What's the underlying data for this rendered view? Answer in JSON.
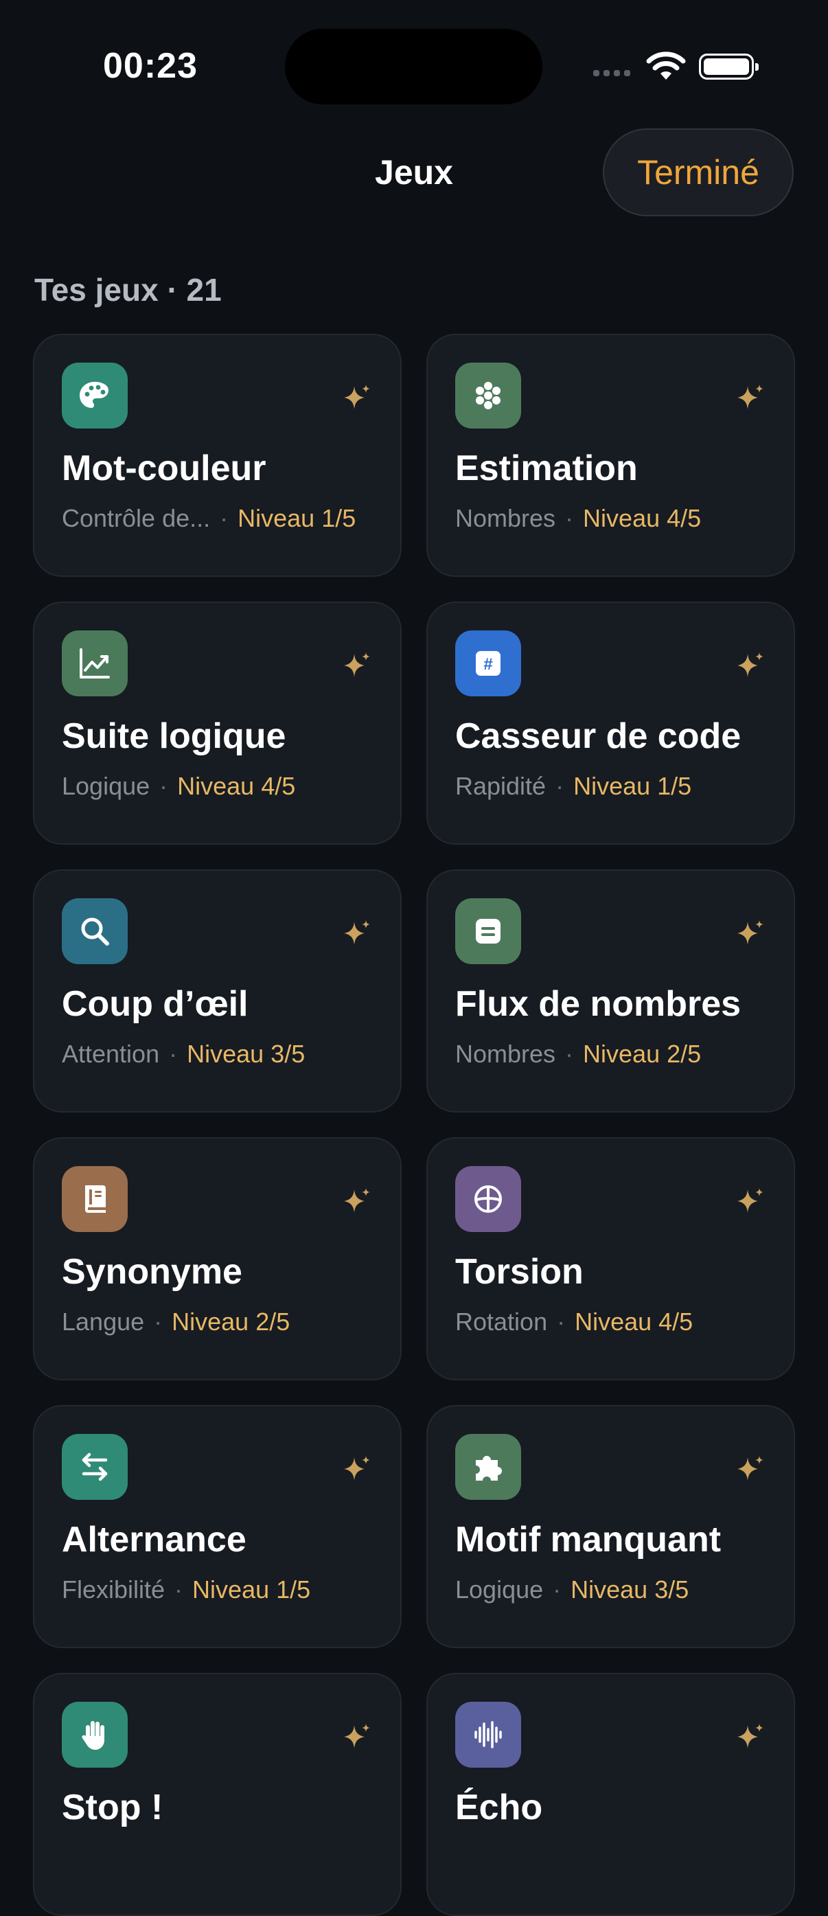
{
  "status_bar": {
    "time": "00:23"
  },
  "nav": {
    "title": "Jeux",
    "done_label": "Terminé"
  },
  "section": {
    "title": "Tes jeux · 21"
  },
  "colors": {
    "accent": "#f0a73a",
    "level": "#e7b865"
  },
  "games": [
    {
      "title": "Mot-couleur",
      "category": "Contrôle de...",
      "level": "Niveau 1/5",
      "icon": "palette-icon",
      "color": "#2f8a76"
    },
    {
      "title": "Estimation",
      "category": "Nombres",
      "level": "Niveau 4/5",
      "icon": "dots-cluster-icon",
      "color": "#4e7a5c"
    },
    {
      "title": "Suite logique",
      "category": "Logique",
      "level": "Niveau 4/5",
      "icon": "chart-trend-icon",
      "color": "#4a7a5a"
    },
    {
      "title": "Casseur de code",
      "category": "Rapidité",
      "level": "Niveau 1/5",
      "icon": "hashtag-icon",
      "color": "#2f6fcf"
    },
    {
      "title": "Coup d’œil",
      "category": "Attention",
      "level": "Niveau 3/5",
      "icon": "magnifier-icon",
      "color": "#2b6f86"
    },
    {
      "title": "Flux de nombres",
      "category": "Nombres",
      "level": "Niveau 2/5",
      "icon": "stream-card-icon",
      "color": "#4e7a5c"
    },
    {
      "title": "Synonyme",
      "category": "Langue",
      "level": "Niveau 2/5",
      "icon": "book-icon",
      "color": "#9a6e4c"
    },
    {
      "title": "Torsion",
      "category": "Rotation",
      "level": "Niveau 4/5",
      "icon": "globe-icon",
      "color": "#6f5a8e"
    },
    {
      "title": "Alternance",
      "category": "Flexibilité",
      "level": "Niveau 1/5",
      "icon": "arrows-swap-icon",
      "color": "#2f8a76"
    },
    {
      "title": "Motif manquant",
      "category": "Logique",
      "level": "Niveau 3/5",
      "icon": "puzzle-icon",
      "color": "#4e7a5c"
    },
    {
      "title": "Stop !",
      "category": "",
      "level": "",
      "icon": "hand-icon",
      "color": "#2f8a76"
    },
    {
      "title": "Écho",
      "category": "",
      "level": "",
      "icon": "waveform-icon",
      "color": "#5a5f9e"
    }
  ]
}
